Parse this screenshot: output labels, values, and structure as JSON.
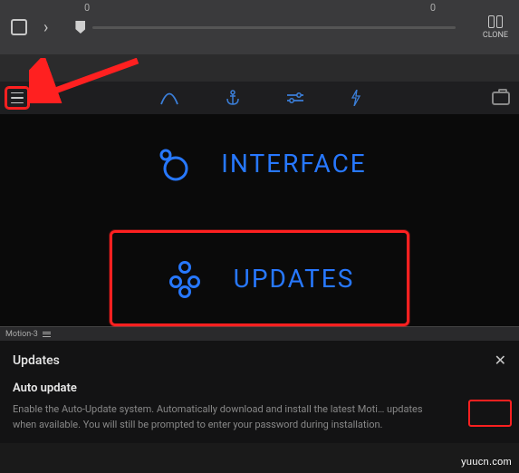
{
  "topbar": {
    "timeline_start": "0",
    "timeline_end": "0",
    "clone_label": "CLONE"
  },
  "menu": {
    "interface": {
      "label": "INTERFACE"
    },
    "updates": {
      "label": "UPDATES"
    }
  },
  "panel": {
    "name": "Motion-3"
  },
  "updates_panel": {
    "title": "Updates",
    "section_title": "Auto update",
    "description": "Enable the Auto-Update system. Automatically download and install the latest Moti… updates when available. You will still be prompted to enter your password during installation."
  },
  "watermark": "yuucn.com",
  "colors": {
    "accent_blue": "#2778ff",
    "highlight_red": "#ff2020",
    "bg_dark": "#0a0a0a"
  }
}
